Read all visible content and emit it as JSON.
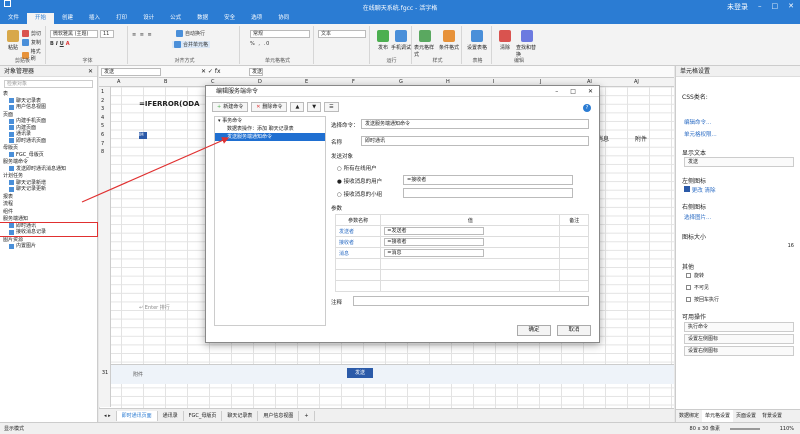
{
  "window": {
    "title": "在线聊天系统.fgcc - 活字格",
    "login": "未登录"
  },
  "tabs": [
    "文件",
    "开始",
    "创建",
    "插入",
    "打印",
    "设计",
    "公式",
    "数据",
    "安全",
    "选项",
    "协同"
  ],
  "ribbon": {
    "paste": "粘贴",
    "cut": "剪切",
    "copy": "复制",
    "format_painter": "格式刷",
    "clipboard": "剪贴板",
    "font_name": "微软雅黑 (主题)",
    "font_size": "11",
    "font": "字体",
    "wrap": "自动换行",
    "merge": "合并单元格",
    "alignment": "对齐方式",
    "number_format": "常规",
    "number": "单元格格式",
    "text_type": "文本",
    "publish": "发布",
    "mobile": "手机调试",
    "run": "运行",
    "table_style": "表元格样式",
    "cond_format": "条件格式",
    "style": "样式",
    "set_table": "设置表格",
    "table": "表格",
    "clear": "清除",
    "find": "查找和替换",
    "edit": "编辑"
  },
  "left_panel": {
    "title": "对象管理器",
    "search": "检索对象",
    "sections": [
      {
        "name": "表",
        "items": [
          "聊天记录表",
          "用户信息视图"
        ]
      },
      {
        "name": "页面",
        "items": [
          "内建手机页面",
          "内建页面",
          "通讯录",
          "即时通讯页面"
        ]
      },
      {
        "name": "母版页",
        "items": [
          "FGC_母版页"
        ]
      },
      {
        "name": "服务端命令",
        "items": [
          "发送即时通讯消息通知"
        ]
      },
      {
        "name": "计划任务",
        "items": [
          "聊天记录新增",
          "聊天记录更新"
        ]
      },
      {
        "name": "报表",
        "items": []
      },
      {
        "name": "流程",
        "items": []
      },
      {
        "name": "组件",
        "items": []
      },
      {
        "name": "服务端通知",
        "items": [
          "即时通讯",
          "接收消息记录"
        ]
      },
      {
        "name": "图片资源",
        "items": [
          "内置图片"
        ]
      }
    ]
  },
  "formula_bar": {
    "name_box": "发送",
    "formula": "发送",
    "cell_text": "=IFERROR(ODA",
    "enter_row": "Enter 排行",
    "attach": "附件",
    "send_btn": "发送"
  },
  "grid_cols": [
    "A",
    "B",
    "C",
    "D",
    "E",
    "F",
    "G",
    "H",
    "I",
    "J",
    "AI",
    "AJ"
  ],
  "grid_rows": [
    "1",
    "2",
    "3",
    "4",
    "5",
    "6",
    "7",
    "8"
  ],
  "grid_labels": {
    "message": "消息",
    "attachment": "附件"
  },
  "sheets": [
    "即时通讯页面",
    "通讯录",
    "FGC_母版页",
    "聊天记录表",
    "用户信息视图"
  ],
  "dialog": {
    "title": "编辑服务端命令",
    "new_btn": "新建命令",
    "delete_btn": "删除命令",
    "tree_root": "事务命令",
    "tree_items": [
      "数据表操作：添加 聊天记录表",
      "发送服务端通知命令"
    ],
    "cmd_label": "选择命令：",
    "cmd_value": "发送服务端通知命令",
    "name_label": "名称",
    "name_value": "即时通讯",
    "target_label": "发送对象",
    "target_all": "所有在线用户",
    "target_receiver": "接收消息的用户",
    "receiver_value": "=接收者",
    "target_group": "接收消息的小组",
    "param_label": "参数",
    "param_headers": [
      "参数名称",
      "值",
      "备注"
    ],
    "params": [
      {
        "name": "发送者",
        "value": "=发送者"
      },
      {
        "name": "接收者",
        "value": "=接收者"
      },
      {
        "name": "消息",
        "value": "=消息"
      }
    ],
    "note_label": "注释",
    "ok": "确定",
    "cancel": "取消"
  },
  "right_panel": {
    "title": "单元格设置",
    "css_label": "CSS类名:",
    "edit_cmd": "编辑命令...",
    "perm": "单元格权限...",
    "display_text_label": "显示文本",
    "display_text": "发送",
    "left_icon": "左侧图标",
    "change": "更改",
    "clear": "清除",
    "right_icon": "右侧图标",
    "select_img": "选择图片...",
    "icon_size_label": "图标大小",
    "icon_size": "16",
    "other": "其他",
    "opt1": "旋转",
    "opt2": "不可见",
    "opt3": "按回车执行",
    "ops": "可用操作",
    "op1": "执行命令",
    "op2": "设置左侧图标",
    "op3": "设置右侧图标",
    "tabs": [
      "数据绑定",
      "单元格设置",
      "页面设置",
      "背景设置"
    ]
  },
  "status": {
    "mode": "显示模式",
    "size": "80 x 30 像素",
    "zoom": "110%"
  }
}
